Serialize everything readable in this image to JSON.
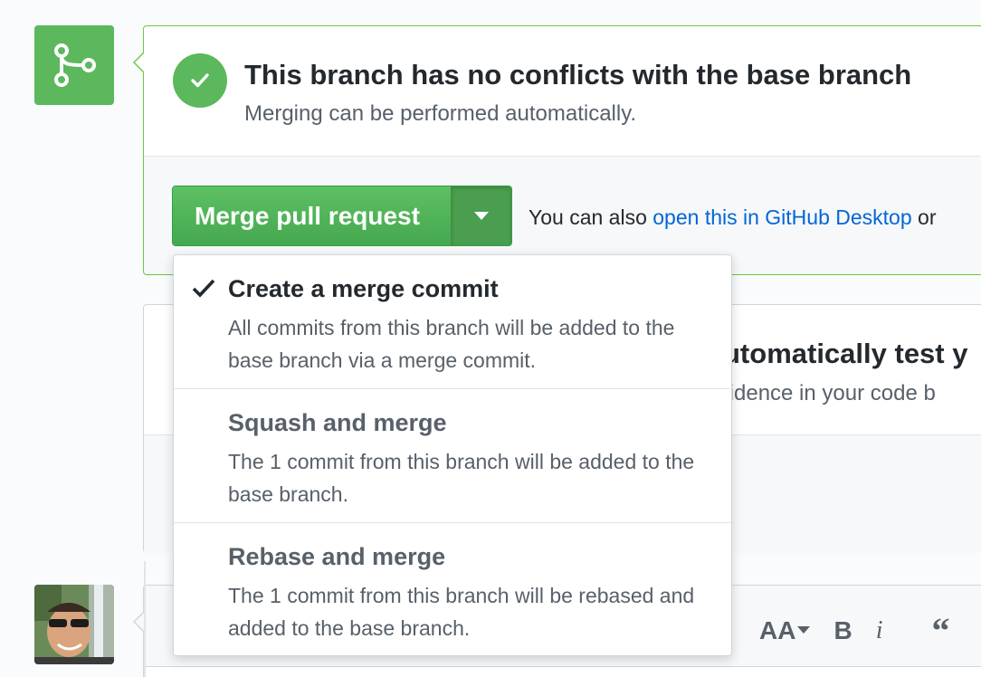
{
  "merge_status": {
    "title": "This branch has no conflicts with the base branch",
    "subtitle": "Merging can be performed automatically."
  },
  "merge_actions": {
    "merge_button_label": "Merge pull request",
    "also_prefix": "You can also ",
    "desktop_link": "open this in GitHub Desktop",
    "also_suffix": " or"
  },
  "merge_menu": {
    "items": [
      {
        "title": "Create a merge commit",
        "description": "All commits from this branch will be added to the base branch via a merge commit.",
        "selected": true
      },
      {
        "title": "Squash and merge",
        "description": "The 1 commit from this branch will be added to the base branch.",
        "selected": false
      },
      {
        "title": "Rebase and merge",
        "description": "The 1 commit from this branch will be rebased and added to the base branch.",
        "selected": false
      }
    ]
  },
  "ci_panel": {
    "title_partial": "utomatically test y",
    "subtitle_partial": "fidence in your code b"
  },
  "comment_toolbar": {
    "heading_tool": "AA",
    "bold_tool": "B",
    "italic_tool": "i",
    "quote_tool": "“"
  },
  "colors": {
    "accent_green": "#5cb85c",
    "link_blue": "#0366d6",
    "border_green": "#6cc644"
  },
  "icons": {
    "merge_badge": "git-merge-icon",
    "status": "check-circle-icon",
    "dropdown": "triangle-down-icon",
    "menu_selected": "check-icon"
  }
}
